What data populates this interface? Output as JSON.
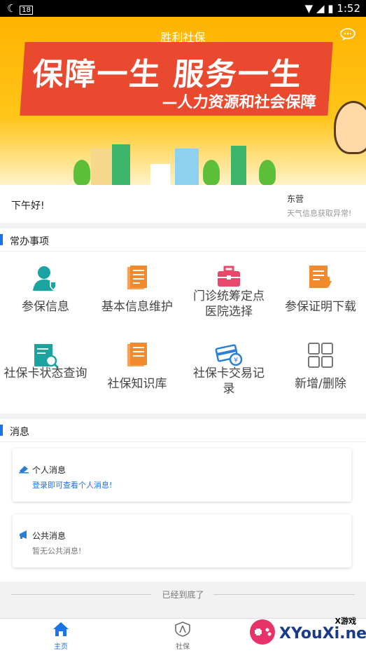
{
  "status_bar": {
    "time": "1:52",
    "notification": "18"
  },
  "header": {
    "title": "胜利社保"
  },
  "banner": {
    "slogan_main": "保障一生 服务一生",
    "slogan_sub": "—人力资源和社会保障"
  },
  "greeting": {
    "text": "下午好!",
    "city": "东营",
    "weather_status": "天气信息获取异常!"
  },
  "common_tasks": {
    "title": "常办事项",
    "items": [
      {
        "label": "参保信息",
        "icon": "user-shield-icon",
        "color": "#1ba3a0"
      },
      {
        "label": "基本信息维护",
        "icon": "document-list-icon",
        "color": "#f08a2c"
      },
      {
        "label": "门诊统筹定点医院选择",
        "icon": "medical-kit-icon",
        "color": "#e8496a"
      },
      {
        "label": "参保证明下载",
        "icon": "download-document-icon",
        "color": "#f08a2c"
      },
      {
        "label": "社保卡状态查询",
        "icon": "search-document-icon",
        "color": "#1ba3a0"
      },
      {
        "label": "社保知识库",
        "icon": "knowledge-book-icon",
        "color": "#f08a2c"
      },
      {
        "label": "社保卡交易记录",
        "icon": "card-transaction-icon",
        "color": "#2b7fd6"
      },
      {
        "label": "新增/删除",
        "icon": "grid-icon",
        "color": "#777777"
      }
    ]
  },
  "messages": {
    "title": "消息",
    "personal": {
      "title": "个人消息",
      "text": "登录即可查看个人消息!"
    },
    "public": {
      "title": "公共消息",
      "text": "暂无公共消息!"
    }
  },
  "footer_text": "已经到底了",
  "tabs": [
    {
      "label": "主页",
      "active": true
    },
    {
      "label": "社保",
      "active": false
    }
  ],
  "watermark": {
    "brand": "XYouXi.net",
    "tag": "X游戏"
  },
  "accent": "#1a73e8"
}
